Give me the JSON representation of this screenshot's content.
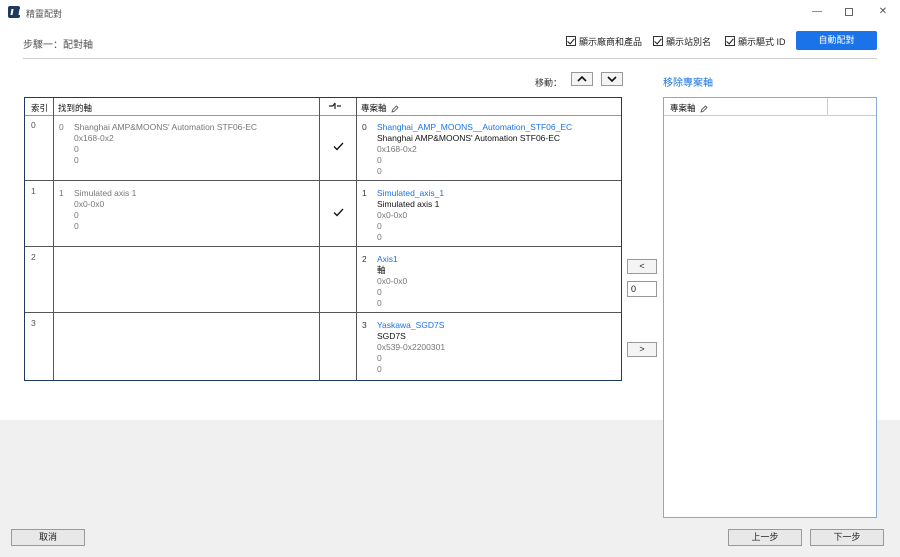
{
  "window": {
    "title": "精靈配對"
  },
  "header": {
    "step_title": "步驟一：配對軸",
    "options": [
      {
        "label": "顯示廠商和產品",
        "checked": true
      },
      {
        "label": "顯示站別名",
        "checked": true
      },
      {
        "label": "顯示驅式 ID",
        "checked": true
      }
    ],
    "auto_match_label": "自動配對"
  },
  "toolbar": {
    "move_label": "移動：",
    "remove_project_axis": "移除專案軸"
  },
  "grid": {
    "columns": {
      "index": "索引",
      "found_axis": "找到的軸",
      "link_icon": "link-toggle-icon",
      "project_axis": "專案軸"
    },
    "rows": [
      {
        "index": "0",
        "found": {
          "num": "0",
          "name": "Shanghai AMP&MOONS' Automation STF06-EC",
          "addr": "0x168-0x2",
          "v1": "0",
          "v2": "0"
        },
        "matched": true,
        "project": {
          "num": "0",
          "link": "Shanghai_AMP_MOONS__Automation_STF06_EC",
          "name": "Shanghai AMP&MOONS' Automation STF06-EC",
          "addr": "0x168-0x2",
          "v1": "0",
          "v2": "0"
        }
      },
      {
        "index": "1",
        "found": {
          "num": "1",
          "name": "Simulated axis 1",
          "addr": "0x0-0x0",
          "v1": "0",
          "v2": "0"
        },
        "matched": true,
        "project": {
          "num": "1",
          "link": "Simulated_axis_1",
          "name": "Simulated axis 1",
          "addr": "0x0-0x0",
          "v1": "0",
          "v2": "0"
        }
      },
      {
        "index": "2",
        "found": null,
        "matched": false,
        "project": {
          "num": "2",
          "link": "Axis1",
          "name": "軸",
          "addr": "0x0-0x0",
          "v1": "0",
          "v2": "0"
        }
      },
      {
        "index": "3",
        "found": null,
        "matched": false,
        "project": {
          "num": "3",
          "link": "Yaskawa_SGD7S",
          "name": "SGD7S",
          "addr": "0x539-0x2200301",
          "v1": "0",
          "v2": "0"
        }
      }
    ]
  },
  "side_controls": {
    "left_label": "<",
    "right_label": ">",
    "position_value": "0"
  },
  "project_panel": {
    "header": "專案軸"
  },
  "footer": {
    "cancel_label": "取消",
    "prev_label": "上一步",
    "next_label": "下一步"
  },
  "colors": {
    "accent": "#1a73e8",
    "grid_border": "#1f3a5f"
  }
}
